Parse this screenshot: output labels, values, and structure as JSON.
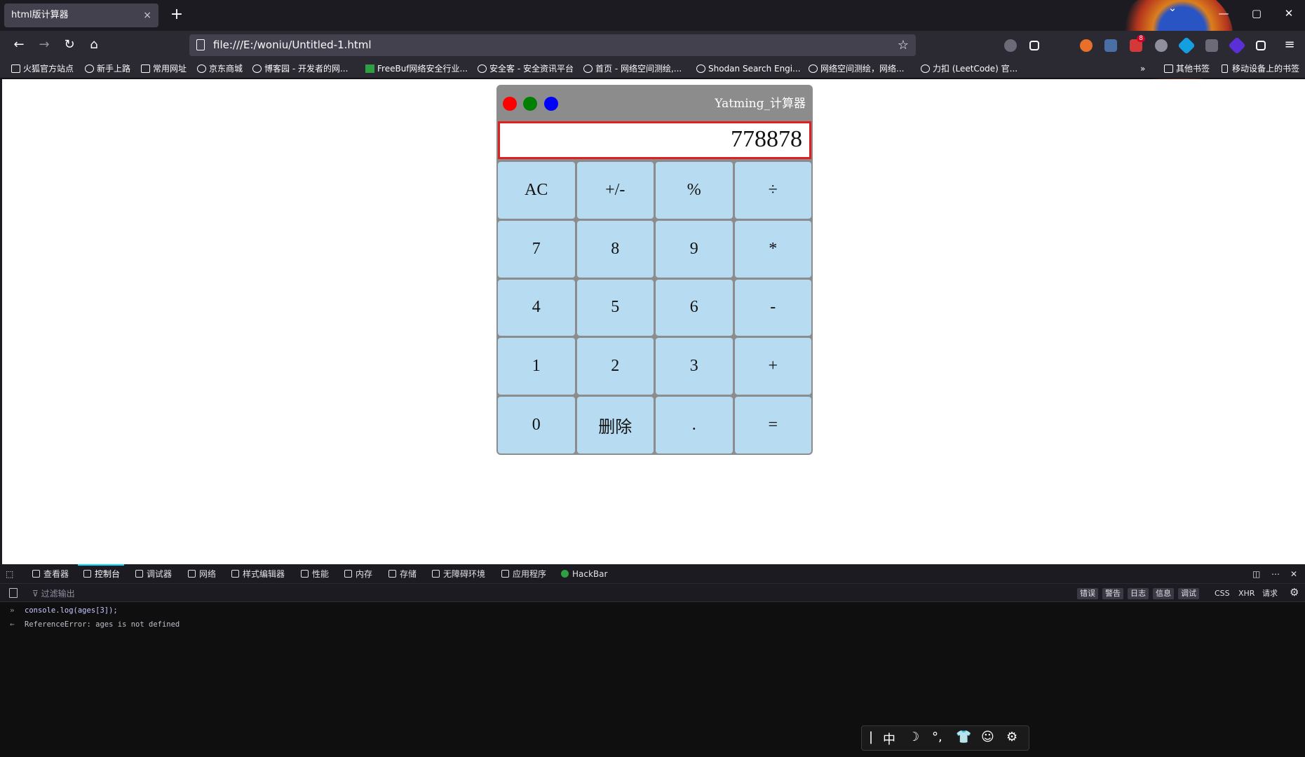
{
  "browser": {
    "tab_title": "html版计算器",
    "tab_close": "×",
    "new_tab": "+",
    "window_controls": [
      "—",
      "▢",
      "✕"
    ],
    "url": "file:///E:/woniu/Untitled-1.html",
    "nav": {
      "back": "←",
      "forward": "→",
      "reload": "↻",
      "home": "⌂",
      "bookmark_star": "☆",
      "menu": "≡"
    },
    "extension_badge": "8",
    "bookmarks": [
      "火狐官方站点",
      "新手上路",
      "常用网址",
      "京东商城",
      "博客园 - 开发者的网...",
      "FreeBuf网络安全行业...",
      "安全客 - 安全资讯平台",
      "首页 - 网络空间测绘,...",
      "Shodan Search Engi...",
      "网络空间测绘，网络...",
      "力扣 (LeetCode) 官..."
    ],
    "bookmarks_overflow": "»",
    "other_bookmarks": "其他书签",
    "mobile_bookmarks": "移动设备上的书签"
  },
  "calculator": {
    "title": "Yatming_计算器",
    "display": "778878",
    "dot_colors": [
      "#ff0000",
      "#008000",
      "#0000ff"
    ],
    "keys": [
      "AC",
      "+/-",
      "%",
      "÷",
      "7",
      "8",
      "9",
      "*",
      "4",
      "5",
      "6",
      "-",
      "1",
      "2",
      "3",
      "+",
      "0",
      "删除",
      ".",
      "="
    ]
  },
  "devtools": {
    "tabs": [
      "查看器",
      "控制台",
      "调试器",
      "网络",
      "样式编辑器",
      "性能",
      "内存",
      "存储",
      "无障碍环境",
      "应用程序",
      "HackBar"
    ],
    "active_tab": "控制台",
    "filter_placeholder": "过滤输出",
    "levels": [
      "错误",
      "警告",
      "日志",
      "信息",
      "调试"
    ],
    "extra_filters": [
      "CSS",
      "XHR",
      "请求"
    ],
    "console": {
      "input": "console.log(ages[3]);",
      "output": "ReferenceError: ages is not defined"
    },
    "ime_toolbar": [
      "|",
      "中",
      "☽",
      "°,",
      "👕",
      "☺",
      "⚙"
    ]
  }
}
